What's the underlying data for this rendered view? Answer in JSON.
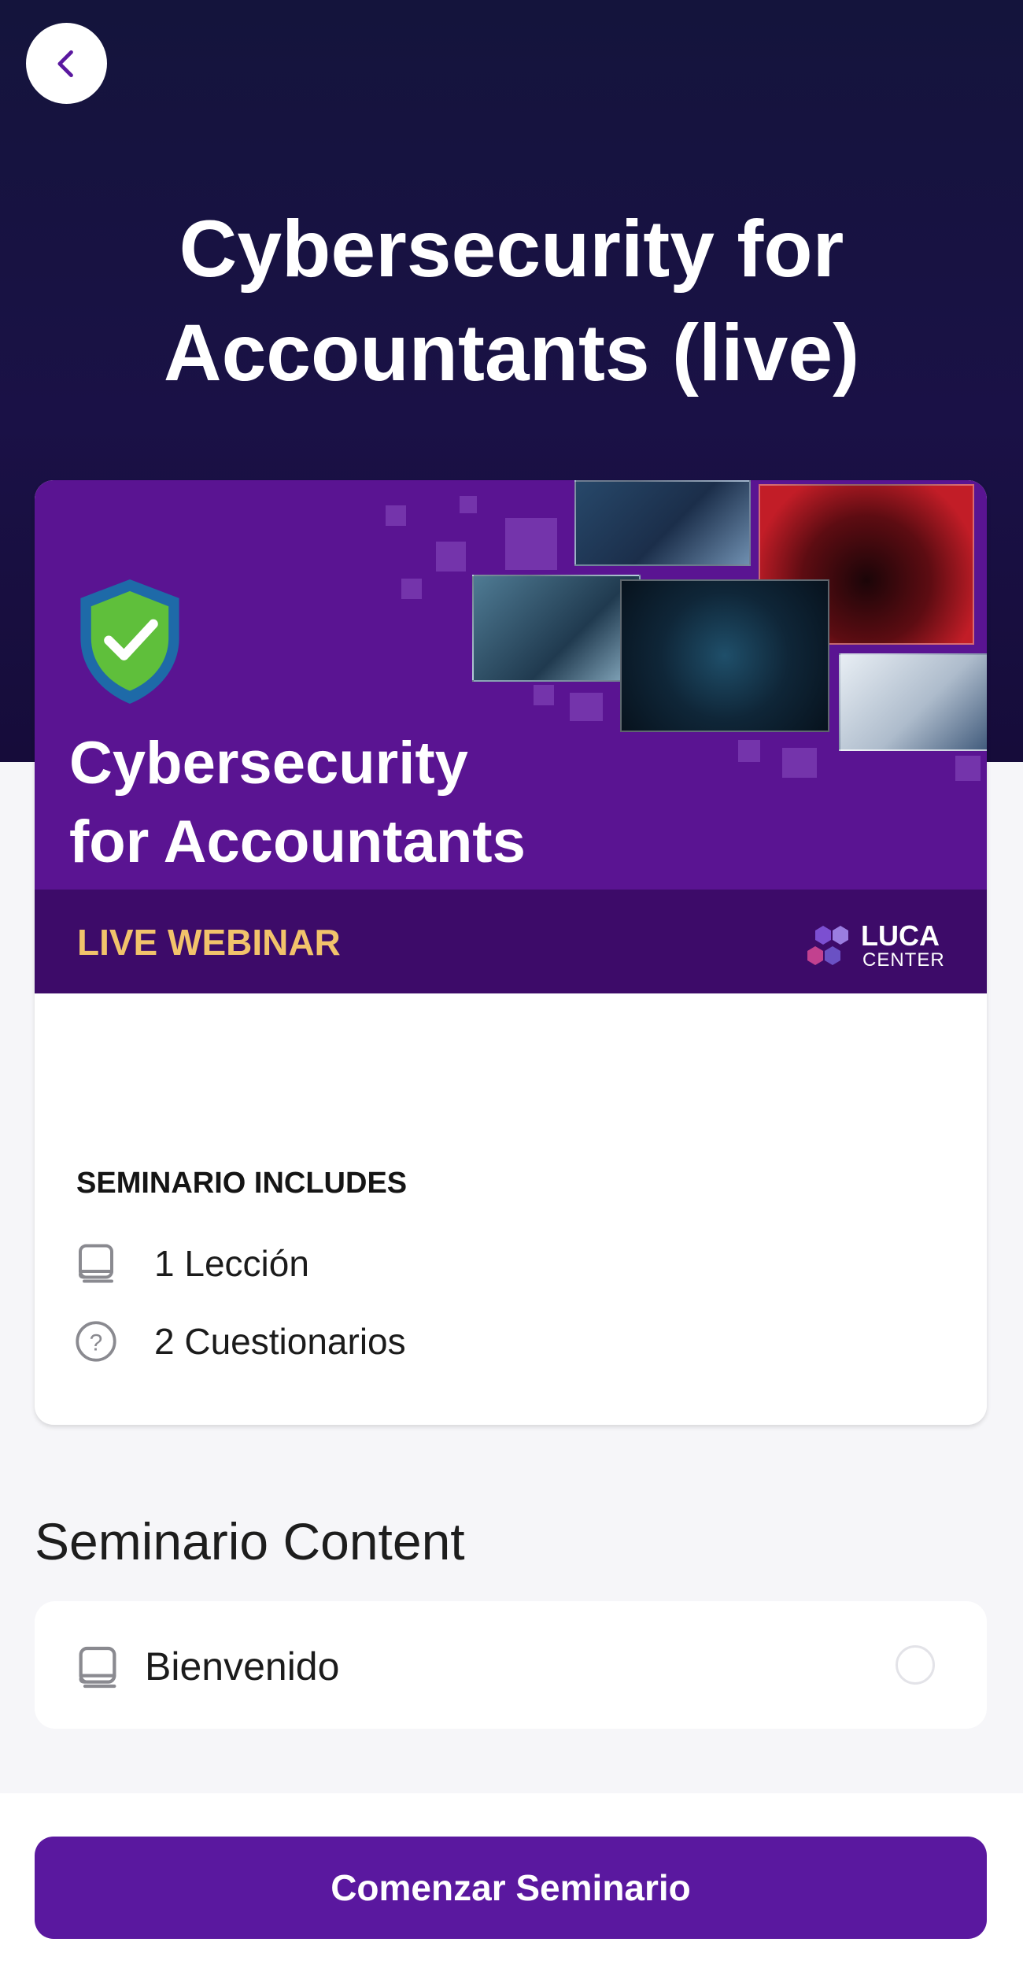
{
  "header": {
    "back_icon": "chevron-left-icon",
    "title": "Cybersecurity for Accountants (live)"
  },
  "banner": {
    "title_line1": "Cybersecurity",
    "title_line2": "for Accountants",
    "subtitle": "LIVE WEBINAR",
    "logo_text1": "LUCA",
    "logo_text2": "CENTER",
    "shield_icon": "shield-check-icon"
  },
  "includes": {
    "heading": "SEMINARIO INCLUDES",
    "items": [
      {
        "icon": "book-icon",
        "label": "1 Lección"
      },
      {
        "icon": "question-circle-icon",
        "label": "2 Cuestionarios"
      }
    ]
  },
  "content": {
    "heading": "Seminario Content",
    "lessons": [
      {
        "icon": "book-icon",
        "label": "Bienvenido",
        "completed": false
      }
    ]
  },
  "cta": {
    "label": "Comenzar Seminario"
  },
  "colors": {
    "hero": "#14143c",
    "banner": "#5a1492",
    "accent": "#5a189f",
    "webinar_text": "#f2c36b"
  }
}
